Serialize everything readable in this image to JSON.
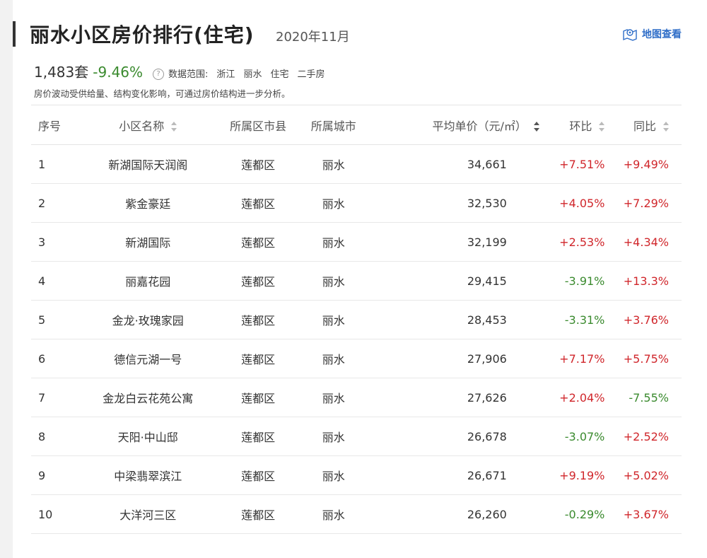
{
  "header": {
    "title": "丽水小区房价排行(住宅)",
    "period": "2020年11月",
    "map_link": "地图查看"
  },
  "summary": {
    "count": "1,483套",
    "change": "-9.46%",
    "scope_label": "数据范围:",
    "scope_items": [
      "浙江",
      "丽水",
      "住宅",
      "二手房"
    ],
    "note": "房价波动受供给量、结构变化影响，可通过房价结构进一步分析。"
  },
  "colors": {
    "up": "#d0262b",
    "down": "#3a8a2e",
    "link": "#2f6ec8"
  },
  "table": {
    "headers": [
      "序号",
      "小区名称",
      "所属区市县",
      "所属城市",
      "平均单价（元/㎡）",
      "环比",
      "同比"
    ],
    "rows": [
      [
        "1",
        "新湖国际天润阁",
        "莲都区",
        "丽水",
        "34,661",
        "+7.51%",
        "+9.49%"
      ],
      [
        "2",
        "紫金豪廷",
        "莲都区",
        "丽水",
        "32,530",
        "+4.05%",
        "+7.29%"
      ],
      [
        "3",
        "新湖国际",
        "莲都区",
        "丽水",
        "32,199",
        "+2.53%",
        "+4.34%"
      ],
      [
        "4",
        "丽嘉花园",
        "莲都区",
        "丽水",
        "29,415",
        "-3.91%",
        "+13.3%"
      ],
      [
        "5",
        "金龙·玫瑰家园",
        "莲都区",
        "丽水",
        "28,453",
        "-3.31%",
        "+3.76%"
      ],
      [
        "6",
        "德信元湖一号",
        "莲都区",
        "丽水",
        "27,906",
        "+7.17%",
        "+5.75%"
      ],
      [
        "7",
        "金龙白云花苑公寓",
        "莲都区",
        "丽水",
        "27,626",
        "+2.04%",
        "-7.55%"
      ],
      [
        "8",
        "天阳·中山邸",
        "莲都区",
        "丽水",
        "26,678",
        "-3.07%",
        "+2.52%"
      ],
      [
        "9",
        "中梁翡翠滨江",
        "莲都区",
        "丽水",
        "26,671",
        "+9.19%",
        "+5.02%"
      ],
      [
        "10",
        "大洋河三区",
        "莲都区",
        "丽水",
        "26,260",
        "-0.29%",
        "+3.67%"
      ]
    ]
  }
}
